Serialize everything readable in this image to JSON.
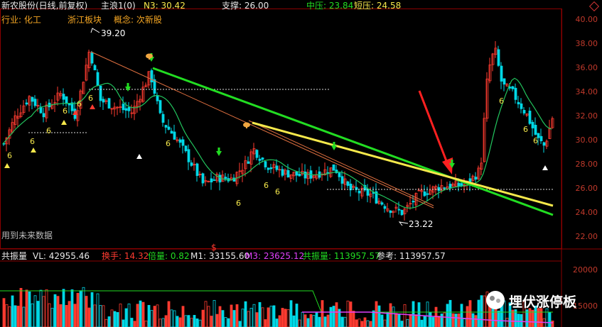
{
  "header": {
    "stock_name": "新农股份(日线,前复权)",
    "indicator": "主浪1(0)",
    "n3_label": "N3: 30.42",
    "support_label": "支撑: 26.00",
    "mid_pressure_label": "中压: 23.84",
    "short_pressure_label": "短压: 24.58"
  },
  "tags": {
    "industry_label": "行业: 化工",
    "region_label": "浙江板块",
    "concept_label": "概念: 次新股"
  },
  "annotations": {
    "high_price": "39.20",
    "low_price": "23.22",
    "future_data_note": "用到未来数据",
    "dollar_mark": "$",
    "six_marker": "6"
  },
  "volume_header": {
    "title": "共振量",
    "vl": "VL: 42955.46",
    "turnover": "换手: 14.32",
    "ratio": "倍量: 0.82",
    "m1": "M1: 33155.60",
    "m3": "M3: 23625.12",
    "resonance": "共振量: 113957.57",
    "reference": "参考: 113957.57"
  },
  "price_axis": [
    "40.00",
    "38.00",
    "36.00",
    "34.00",
    "32.00",
    "30.00",
    "28.00",
    "26.00",
    "24.00",
    "22.00"
  ],
  "volume_axis": [
    "20000",
    "15000"
  ],
  "watermark": {
    "text": "埋伏涨停板",
    "icon": "wechat-icon"
  },
  "colors": {
    "up": "#ff3b30",
    "down": "#00d8e6",
    "ma": "#22c55e",
    "trend_green": "#22dd22",
    "trend_yellow": "#f5e84b",
    "trend_orange": "#e07040",
    "axis_text": "#c0392b",
    "arrow_red": "#ff2020"
  }
}
